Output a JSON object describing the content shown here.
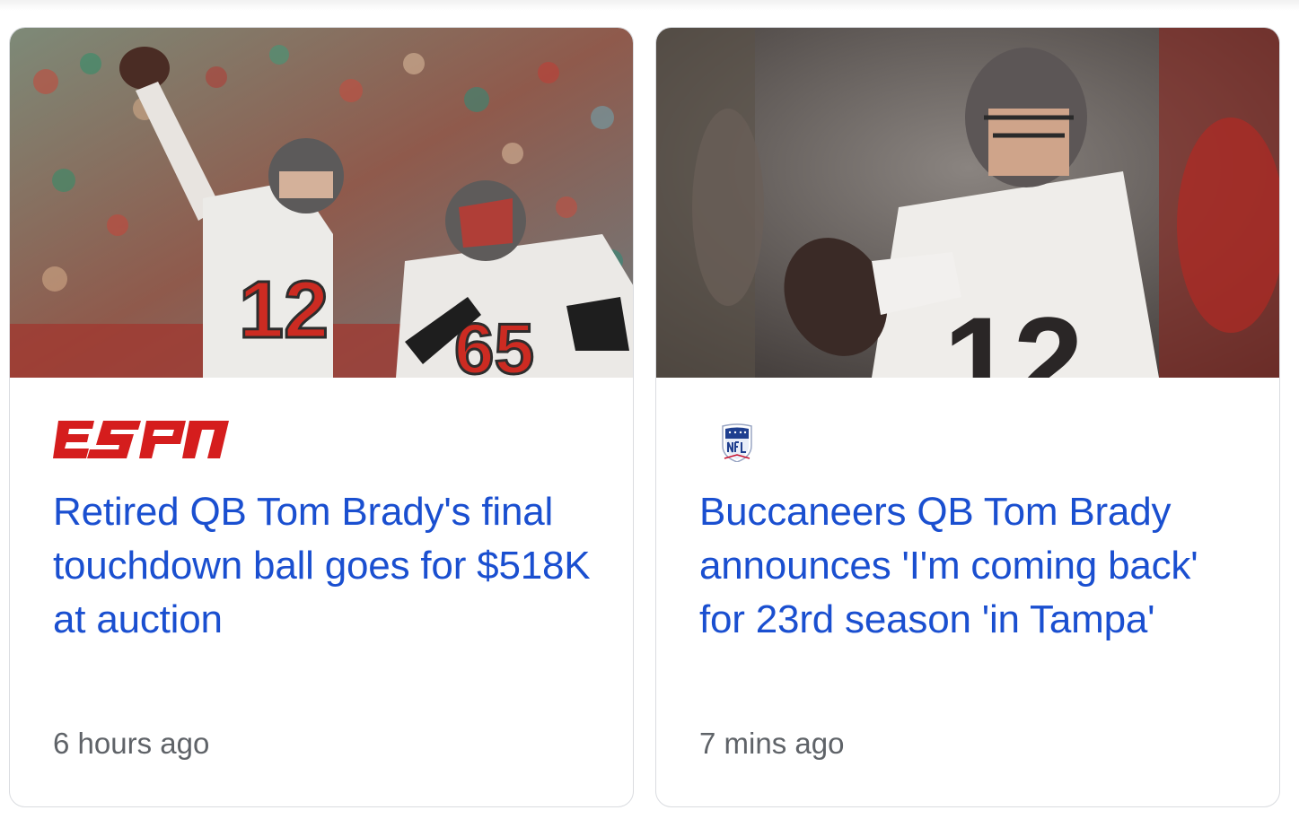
{
  "cards": [
    {
      "source": "ESPN",
      "source_logo_icon": "espn-logo-icon",
      "headline": "Retired QB Tom Brady's final touchdown ball goes for $518K at auction",
      "time": "6 hours ago",
      "jersey_numbers": [
        "12",
        "65"
      ]
    },
    {
      "source": "NFL",
      "source_logo_icon": "nfl-shield-icon",
      "headline": "Buccaneers QB Tom Brady announces 'I'm coming back' for 23rd season 'in Tampa'",
      "time": "7 mins ago",
      "jersey_numbers": [
        "12"
      ]
    }
  ],
  "colors": {
    "headline": "#1a4fd0",
    "timestamp": "#5f6368",
    "espn_red": "#d51d1d",
    "card_border": "#dadce0"
  }
}
